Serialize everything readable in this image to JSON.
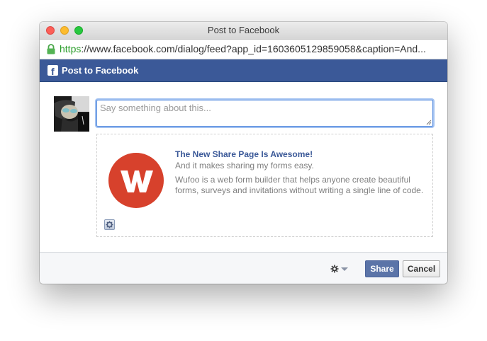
{
  "window": {
    "title": "Post to Facebook"
  },
  "address_bar": {
    "scheme": "https",
    "host_and_path": "://www.facebook.com/dialog/feed?app_id=1603605129859058&caption=And..."
  },
  "dialog": {
    "header_title": "Post to Facebook",
    "brand_color": "#3b5998"
  },
  "composer": {
    "placeholder": "Say something about this...",
    "value": ""
  },
  "preview": {
    "title": "The New Share Page Is Awesome!",
    "caption": "And it makes sharing my forms easy.",
    "description": "Wufoo is a web form builder that helps anyone create beautiful forms, surveys and invitations without writing a single line of code.",
    "logo_letter": "W",
    "logo_color": "#d7412c"
  },
  "footer": {
    "share_label": "Share",
    "cancel_label": "Cancel"
  },
  "icons": {
    "lock": "lock-icon",
    "facebook": "facebook-logo-icon",
    "gear": "gear-icon",
    "caret": "chevron-down-icon"
  }
}
